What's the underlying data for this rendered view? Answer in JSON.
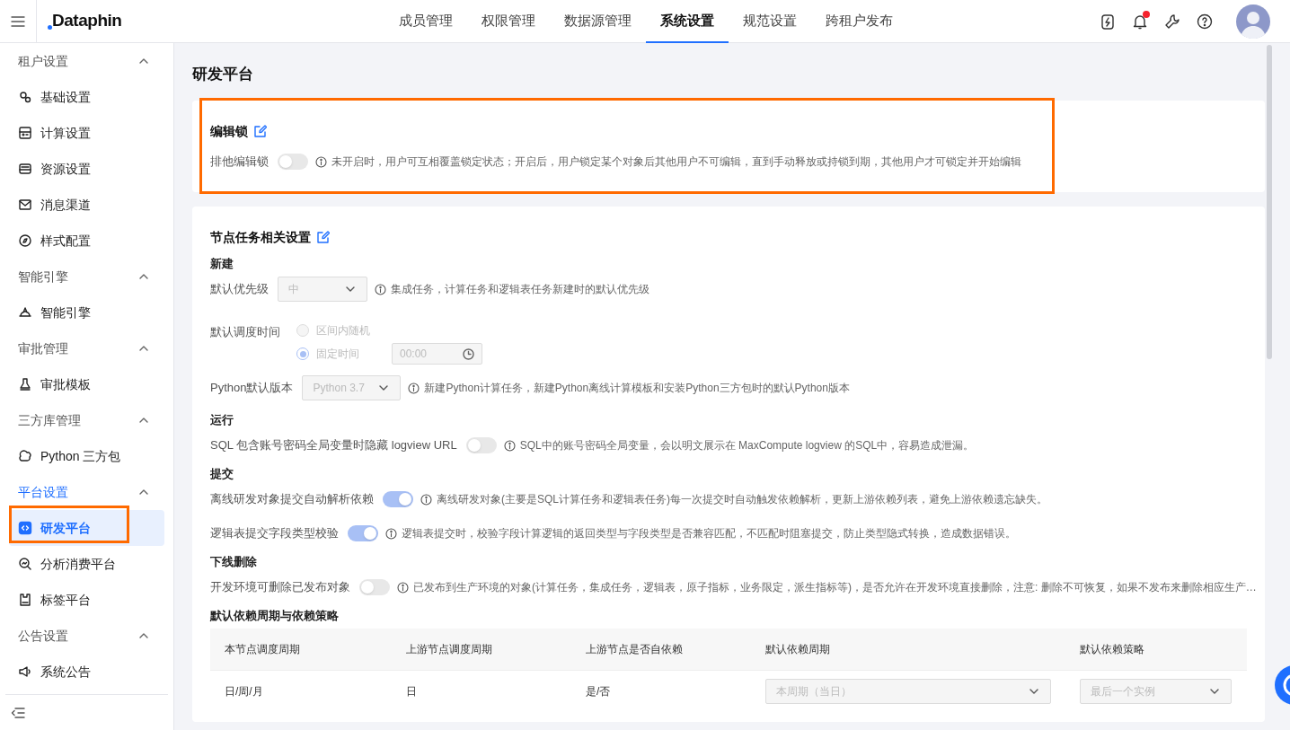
{
  "topbar": {
    "brand": "Dataphin",
    "nav": [
      {
        "label": "成员管理",
        "selected": false
      },
      {
        "label": "权限管理",
        "selected": false
      },
      {
        "label": "数据源管理",
        "selected": false
      },
      {
        "label": "系统设置",
        "selected": true
      },
      {
        "label": "规范设置",
        "selected": false
      },
      {
        "label": "跨租户发布",
        "selected": false
      }
    ],
    "notification_dot": true
  },
  "sidebar": {
    "groups": [
      {
        "label": "租户设置",
        "expanded": true,
        "active": false,
        "items": [
          {
            "label": "基础设置",
            "selected": false,
            "highlighted": false
          },
          {
            "label": "计算设置",
            "selected": false,
            "highlighted": false
          },
          {
            "label": "资源设置",
            "selected": false,
            "highlighted": false
          },
          {
            "label": "消息渠道",
            "selected": false,
            "highlighted": false
          },
          {
            "label": "样式配置",
            "selected": false,
            "highlighted": false
          }
        ]
      },
      {
        "label": "智能引擎",
        "expanded": true,
        "active": false,
        "items": [
          {
            "label": "智能引擎",
            "selected": false,
            "highlighted": false
          }
        ]
      },
      {
        "label": "审批管理",
        "expanded": true,
        "active": false,
        "items": [
          {
            "label": "审批模板",
            "selected": false,
            "highlighted": false
          }
        ]
      },
      {
        "label": "三方库管理",
        "expanded": true,
        "active": false,
        "items": [
          {
            "label": "Python 三方包",
            "selected": false,
            "highlighted": false
          }
        ]
      },
      {
        "label": "平台设置",
        "expanded": true,
        "active": true,
        "items": [
          {
            "label": "研发平台",
            "selected": true,
            "highlighted": true
          },
          {
            "label": "分析消费平台",
            "selected": false,
            "highlighted": false
          },
          {
            "label": "标签平台",
            "selected": false,
            "highlighted": false
          }
        ]
      },
      {
        "label": "公告设置",
        "expanded": true,
        "active": false,
        "items": [
          {
            "label": "系统公告",
            "selected": false,
            "highlighted": false
          }
        ]
      }
    ]
  },
  "page_title": "研发平台",
  "cards": [
    {
      "title": "编辑锁",
      "highlighted": true,
      "groups": [
        {
          "rows": [
            {
              "kind": "switch",
              "label": "排他编辑锁",
              "on": false,
              "hint": "未开启时，用户可互相覆盖锁定状态；开启后，用户锁定某个对象后其他用户不可编辑，直到手动释放或持锁到期，其他用户才可锁定并开始编辑"
            }
          ]
        }
      ]
    },
    {
      "title": "节点任务相关设置",
      "highlighted": false,
      "groups": [
        {
          "heading": "新建",
          "rows": [
            {
              "kind": "select",
              "label": "默认优先级",
              "value": "中",
              "hint": "集成任务，计算任务和逻辑表任务新建时的默认优先级"
            },
            {
              "kind": "radio",
              "label": "默认调度时间",
              "options": [
                {
                  "label": "区间内随机",
                  "selected": false
                },
                {
                  "label": "固定时间",
                  "selected": true,
                  "time_value": "00:00"
                }
              ]
            },
            {
              "kind": "select",
              "label": "Python默认版本",
              "value": "Python 3.7",
              "hint": "新建Python计算任务，新建Python离线计算模板和安装Python三方包时的默认Python版本"
            }
          ]
        },
        {
          "heading": "运行",
          "rows": [
            {
              "kind": "switch",
              "label": "SQL 包含账号密码全局变量时隐藏 logview URL",
              "on": false,
              "hint": "SQL中的账号密码全局变量，会以明文展示在 MaxCompute logview 的SQL中，容易造成泄漏。"
            }
          ]
        },
        {
          "heading": "提交",
          "rows": [
            {
              "kind": "switch",
              "label": "离线研发对象提交自动解析依赖",
              "on": true,
              "hint": "离线研发对象(主要是SQL计算任务和逻辑表任务)每一次提交时自动触发依赖解析，更新上游依赖列表，避免上游依赖遗忘缺失。"
            },
            {
              "kind": "switch",
              "label": "逻辑表提交字段类型校验",
              "on": true,
              "hint": "逻辑表提交时，校验字段计算逻辑的返回类型与字段类型是否兼容匹配，不匹配时阻塞提交，防止类型隐式转换，造成数据错误。"
            }
          ]
        },
        {
          "heading": "下线删除",
          "rows": [
            {
              "kind": "switch",
              "label": "开发环境可删除已发布对象",
              "on": false,
              "hint": "已发布到生产环境的对象(计算任务，集成任务，逻辑表，原子指标，业务限定，派生指标等)，是否允许在开发环境直接删除，注意: 删除不可恢复，如果不发布来删除相应生产…"
            }
          ]
        },
        {
          "heading": "默认依赖周期与依赖策略",
          "table": {
            "columns": [
              "本节点调度周期",
              "上游节点调度周期",
              "上游节点是否自依赖",
              "默认依赖周期",
              "默认依赖策略"
            ],
            "rows": [
              [
                {
                  "kind": "text",
                  "value": "日/周/月"
                },
                {
                  "kind": "text",
                  "value": "日"
                },
                {
                  "kind": "text",
                  "value": "是/否"
                },
                {
                  "kind": "select",
                  "value": "本周期（当日）"
                },
                {
                  "kind": "select",
                  "value": "最后一个实例"
                }
              ]
            ]
          }
        }
      ]
    }
  ]
}
